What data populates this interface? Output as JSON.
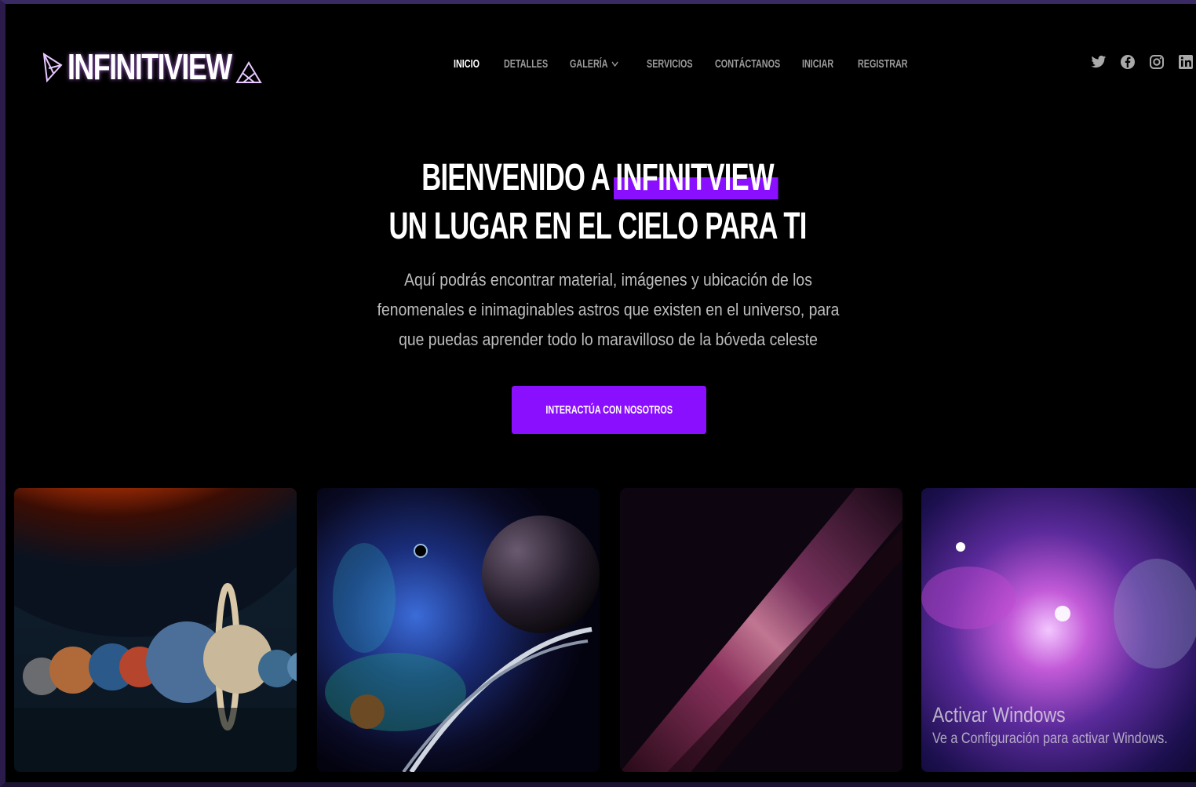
{
  "brand": {
    "name": "INFINITIVIEW",
    "accent_color": "#8b0fff",
    "logo_icon": "triangle-logo-icon"
  },
  "nav": {
    "items": [
      {
        "label": "INICIO",
        "active": true
      },
      {
        "label": "DETALLES",
        "active": false
      },
      {
        "label": "GALERÍA",
        "active": false,
        "has_dropdown": true
      },
      {
        "label": "SERVICIOS",
        "active": false
      },
      {
        "label": "CONTÁCTANOS",
        "active": false
      },
      {
        "label": "INICIAR",
        "active": false
      },
      {
        "label": "REGISTRAR",
        "active": false
      }
    ]
  },
  "social": {
    "icons": [
      "twitter-icon",
      "facebook-icon",
      "instagram-icon",
      "linkedin-icon"
    ]
  },
  "hero": {
    "line1_prefix": "BIENVENIDO A",
    "line1_highlight": "INFINITVIEW",
    "line2": "UN LUGAR EN EL CIELO PARA TI",
    "description": "Aquí podrás encontrar material, imágenes y ubicación de los fenomenales e inimaginables astros que existen en el universo, para que puedas aprender todo lo maravilloso de la bóveda celeste",
    "cta_label": "INTERACTÚA CON NOSOTROS"
  },
  "gallery": {
    "images": [
      {
        "subject": "solar-system-planets-image"
      },
      {
        "subject": "galaxy-planet-ring-image"
      },
      {
        "subject": "milky-way-image"
      },
      {
        "subject": "purple-nebula-image"
      }
    ]
  },
  "watermark": {
    "title": "Activar Windows",
    "subtitle": "Ve a Configuración para activar Windows."
  }
}
